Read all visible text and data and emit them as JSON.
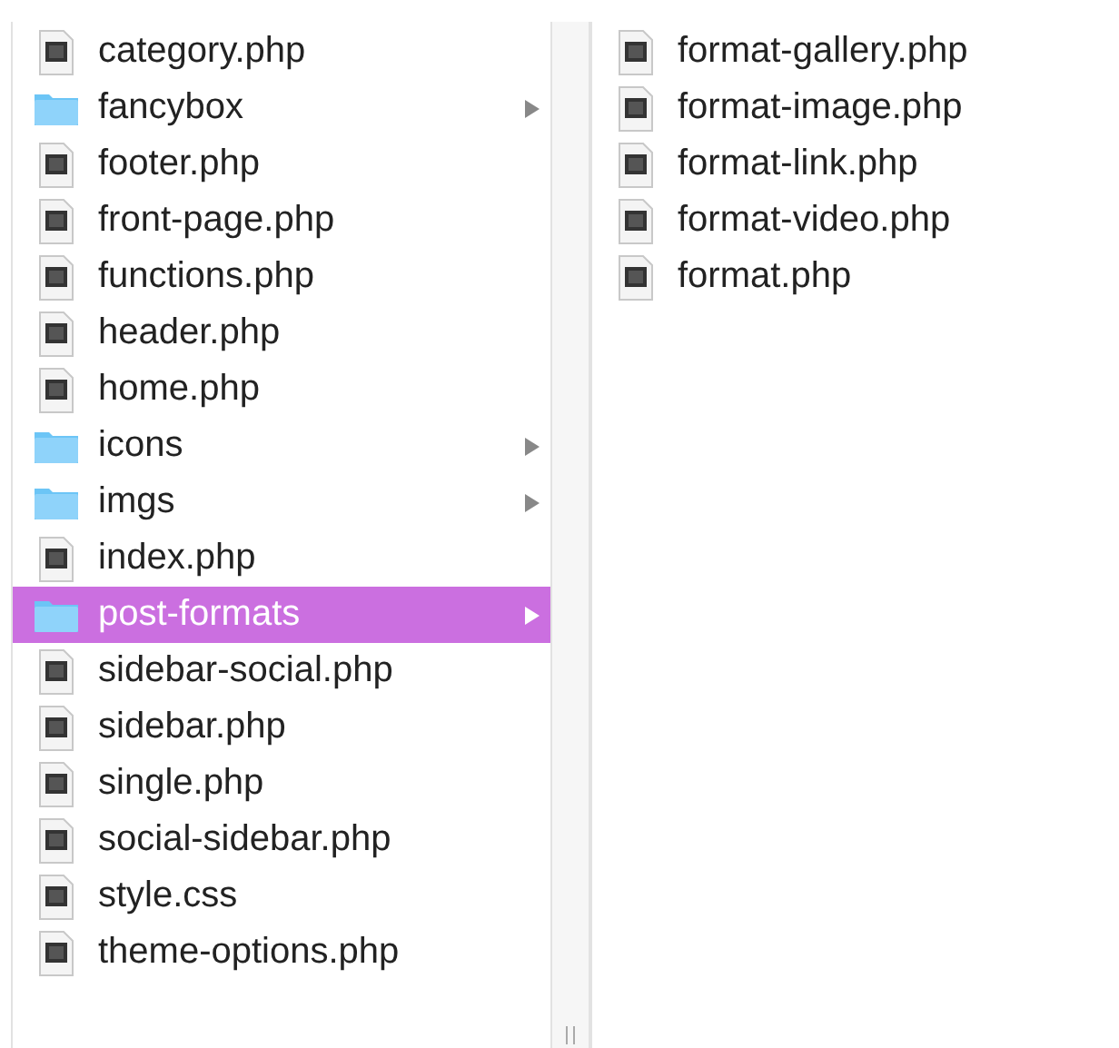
{
  "columns": [
    {
      "items": [
        {
          "name": "category.php",
          "kind": "file",
          "selected": false
        },
        {
          "name": "fancybox",
          "kind": "folder",
          "selected": false
        },
        {
          "name": "footer.php",
          "kind": "file",
          "selected": false
        },
        {
          "name": "front-page.php",
          "kind": "file",
          "selected": false
        },
        {
          "name": "functions.php",
          "kind": "file",
          "selected": false
        },
        {
          "name": "header.php",
          "kind": "file",
          "selected": false
        },
        {
          "name": "home.php",
          "kind": "file",
          "selected": false
        },
        {
          "name": "icons",
          "kind": "folder",
          "selected": false
        },
        {
          "name": "imgs",
          "kind": "folder",
          "selected": false
        },
        {
          "name": "index.php",
          "kind": "file",
          "selected": false
        },
        {
          "name": "post-formats",
          "kind": "folder",
          "selected": true
        },
        {
          "name": "sidebar-social.php",
          "kind": "file",
          "selected": false
        },
        {
          "name": "sidebar.php",
          "kind": "file",
          "selected": false
        },
        {
          "name": "single.php",
          "kind": "file",
          "selected": false
        },
        {
          "name": "social-sidebar.php",
          "kind": "file",
          "selected": false
        },
        {
          "name": "style.css",
          "kind": "file",
          "selected": false
        },
        {
          "name": "theme-options.php",
          "kind": "file",
          "selected": false
        }
      ]
    },
    {
      "items": [
        {
          "name": "format-gallery.php",
          "kind": "file",
          "selected": false
        },
        {
          "name": "format-image.php",
          "kind": "file",
          "selected": false
        },
        {
          "name": "format-link.php",
          "kind": "file",
          "selected": false
        },
        {
          "name": "format-video.php",
          "kind": "file",
          "selected": false
        },
        {
          "name": "format.php",
          "kind": "file",
          "selected": false
        }
      ]
    }
  ]
}
